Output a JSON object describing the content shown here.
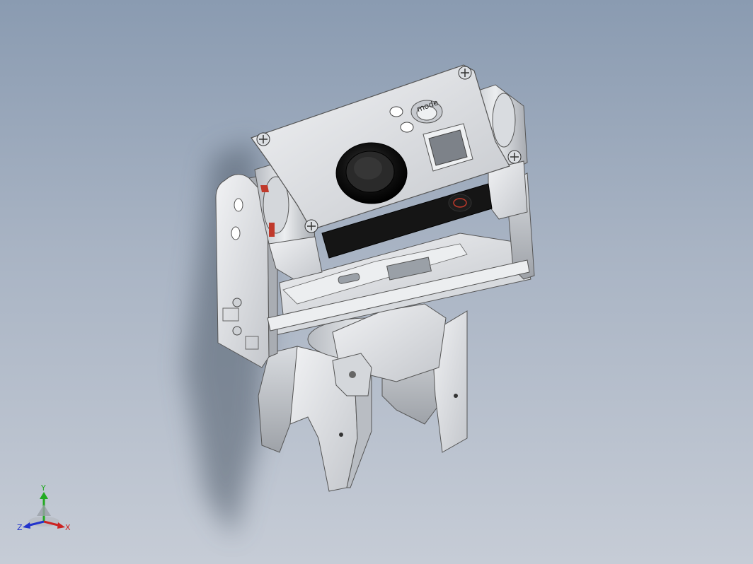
{
  "viewport": {
    "background_top": "#8a9bb1",
    "background_bottom": "#c6ccd6"
  },
  "model": {
    "part_colors": {
      "metal_light": "#e3e5e8",
      "metal_mid": "#c3c6cb",
      "metal_dark": "#8e9298",
      "lens_black": "#121212",
      "accent_red": "#c0392b"
    },
    "camera_button_text": "mode"
  },
  "triad": {
    "y_label": "Y",
    "x_label": "X",
    "z_label": "Z",
    "y_color": "#22aa22",
    "x_color": "#cc2222",
    "z_color": "#2233cc"
  }
}
